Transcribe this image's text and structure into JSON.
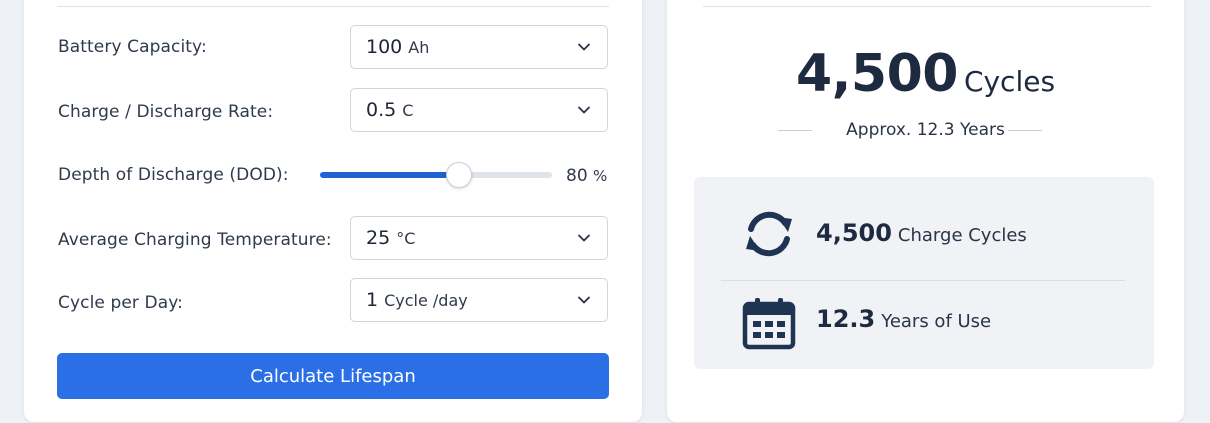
{
  "form": {
    "battery_capacity": {
      "label": "Battery Capacity:",
      "value": "100",
      "unit": "Ah"
    },
    "charge_rate": {
      "label": "Charge / Discharge Rate:",
      "value": "0.5",
      "unit": "C"
    },
    "dod": {
      "label": "Depth of Discharge (DOD):",
      "value": "80",
      "unit": "%",
      "level": 0.6
    },
    "temperature": {
      "label": "Average Charging Temperature:",
      "value": "25",
      "unit": "°C"
    },
    "cycles_per_day": {
      "label": "Cycle per Day:",
      "value": "1",
      "unit": "Cycle /day"
    },
    "calculate_label": "Calculate Lifespan"
  },
  "result": {
    "cycles": "4,500",
    "cycles_unit": "Cycles",
    "approx": "Approx. 12.3 Years",
    "stats": [
      {
        "icon": "refresh-cycle-icon",
        "value": "4,500",
        "text": "Charge Cycles"
      },
      {
        "icon": "calendar-icon",
        "value": "12.3",
        "text": "Years of Use"
      }
    ]
  },
  "colors": {
    "accent": "#2b6fe6",
    "slider_fill": "#1f62d0",
    "heading": "#1e2a40"
  }
}
